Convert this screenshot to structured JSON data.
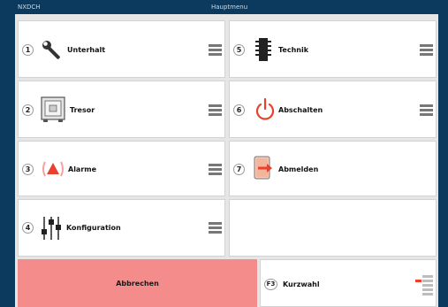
{
  "header": {
    "left": "NXDCH",
    "center": "Hauptmenu"
  },
  "tiles": [
    {
      "num": "1",
      "label": "Unterhalt",
      "icon": "wrench-icon"
    },
    {
      "num": "2",
      "label": "Tresor",
      "icon": "safe-icon"
    },
    {
      "num": "3",
      "label": "Alarme",
      "icon": "alarm-icon"
    },
    {
      "num": "4",
      "label": "Konfiguration",
      "icon": "sliders-icon"
    },
    {
      "num": "5",
      "label": "Technik",
      "icon": "chip-icon"
    },
    {
      "num": "6",
      "label": "Abschalten",
      "icon": "power-icon"
    },
    {
      "num": "7",
      "label": "Abmelden",
      "icon": "logout-icon"
    }
  ],
  "footer": {
    "cancel_label": "Abbrechen",
    "shortcut_key": "F3",
    "shortcut_label": "Kurzwahl",
    "shortcut_icon": "shortcut-list-icon"
  },
  "colors": {
    "accent": "#e8412c",
    "cancel": "#f48c8c",
    "background": "#0b3a5e"
  }
}
